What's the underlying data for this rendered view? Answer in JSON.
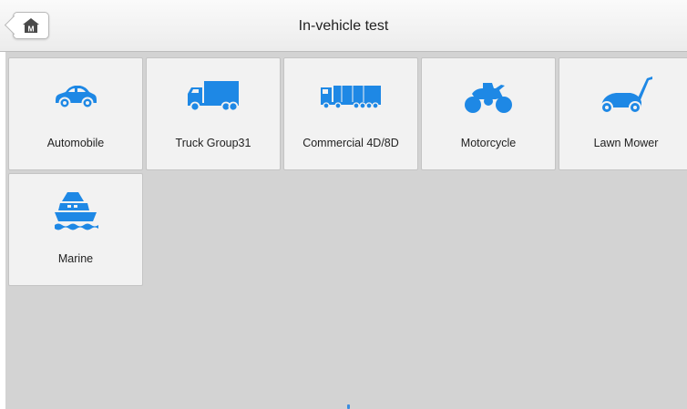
{
  "header": {
    "title": "In-vehicle test",
    "home_button_badge": "M",
    "home_icon": "home-icon"
  },
  "accent_color": "#1e88e5",
  "tiles": [
    {
      "label": "Automobile",
      "icon": "car-icon"
    },
    {
      "label": "Truck Group31",
      "icon": "truck-icon"
    },
    {
      "label": "Commercial 4D/8D",
      "icon": "semi-truck-icon"
    },
    {
      "label": "Motorcycle",
      "icon": "motorcycle-icon"
    },
    {
      "label": "Lawn Mower",
      "icon": "lawn-mower-icon"
    },
    {
      "label": "Marine",
      "icon": "boat-icon"
    }
  ]
}
